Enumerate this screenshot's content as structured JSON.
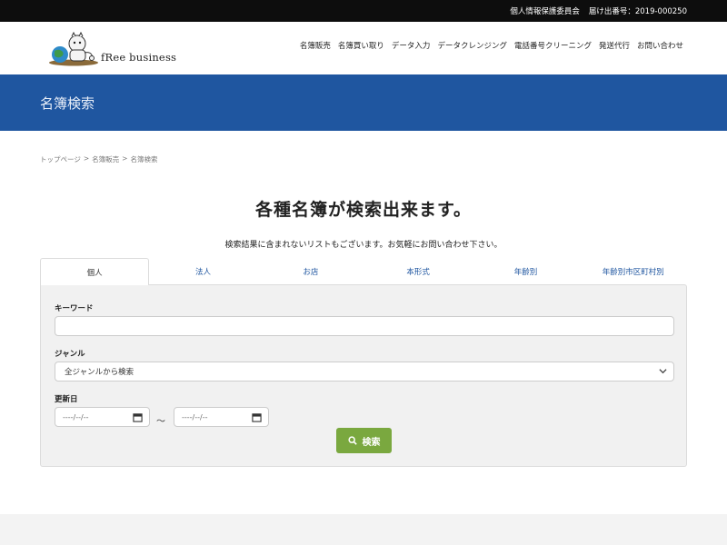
{
  "topbar": {
    "org": "個人情報保護委員会",
    "reg_number": "届け出番号：2019-000250"
  },
  "logo": {
    "text": "fRee business"
  },
  "nav": [
    "名簿販売",
    "名簿買い取り",
    "データ入力",
    "データクレンジング",
    "電話番号クリーニング",
    "発送代行",
    "お問い合わせ"
  ],
  "banner": {
    "title": "名簿検索"
  },
  "breadcrumb": [
    "トップページ",
    "名簿販売",
    "名簿検索"
  ],
  "breadcrumb_sep": ">",
  "main": {
    "title": "各種名簿が検索出来ます。",
    "subtitle": "検索結果に含まれないリストもございます。お気軽にお問い合わせ下さい。"
  },
  "tabs": [
    "個人",
    "法人",
    "お店",
    "本形式",
    "年齢別",
    "年齢別市区町村別"
  ],
  "active_tab": 0,
  "form": {
    "keyword_label": "キーワード",
    "keyword_value": "",
    "genre_label": "ジャンル",
    "genre_selected": "全ジャンルから検索",
    "date_label": "更新日",
    "date_from_placeholder": "----/--/--",
    "date_to_placeholder": "----/--/--",
    "date_sep": "〜",
    "search_label": "検索"
  },
  "colors": {
    "banner": "#1f56a0",
    "search_button": "#7aa83f",
    "topbar": "#0d0d0d"
  }
}
